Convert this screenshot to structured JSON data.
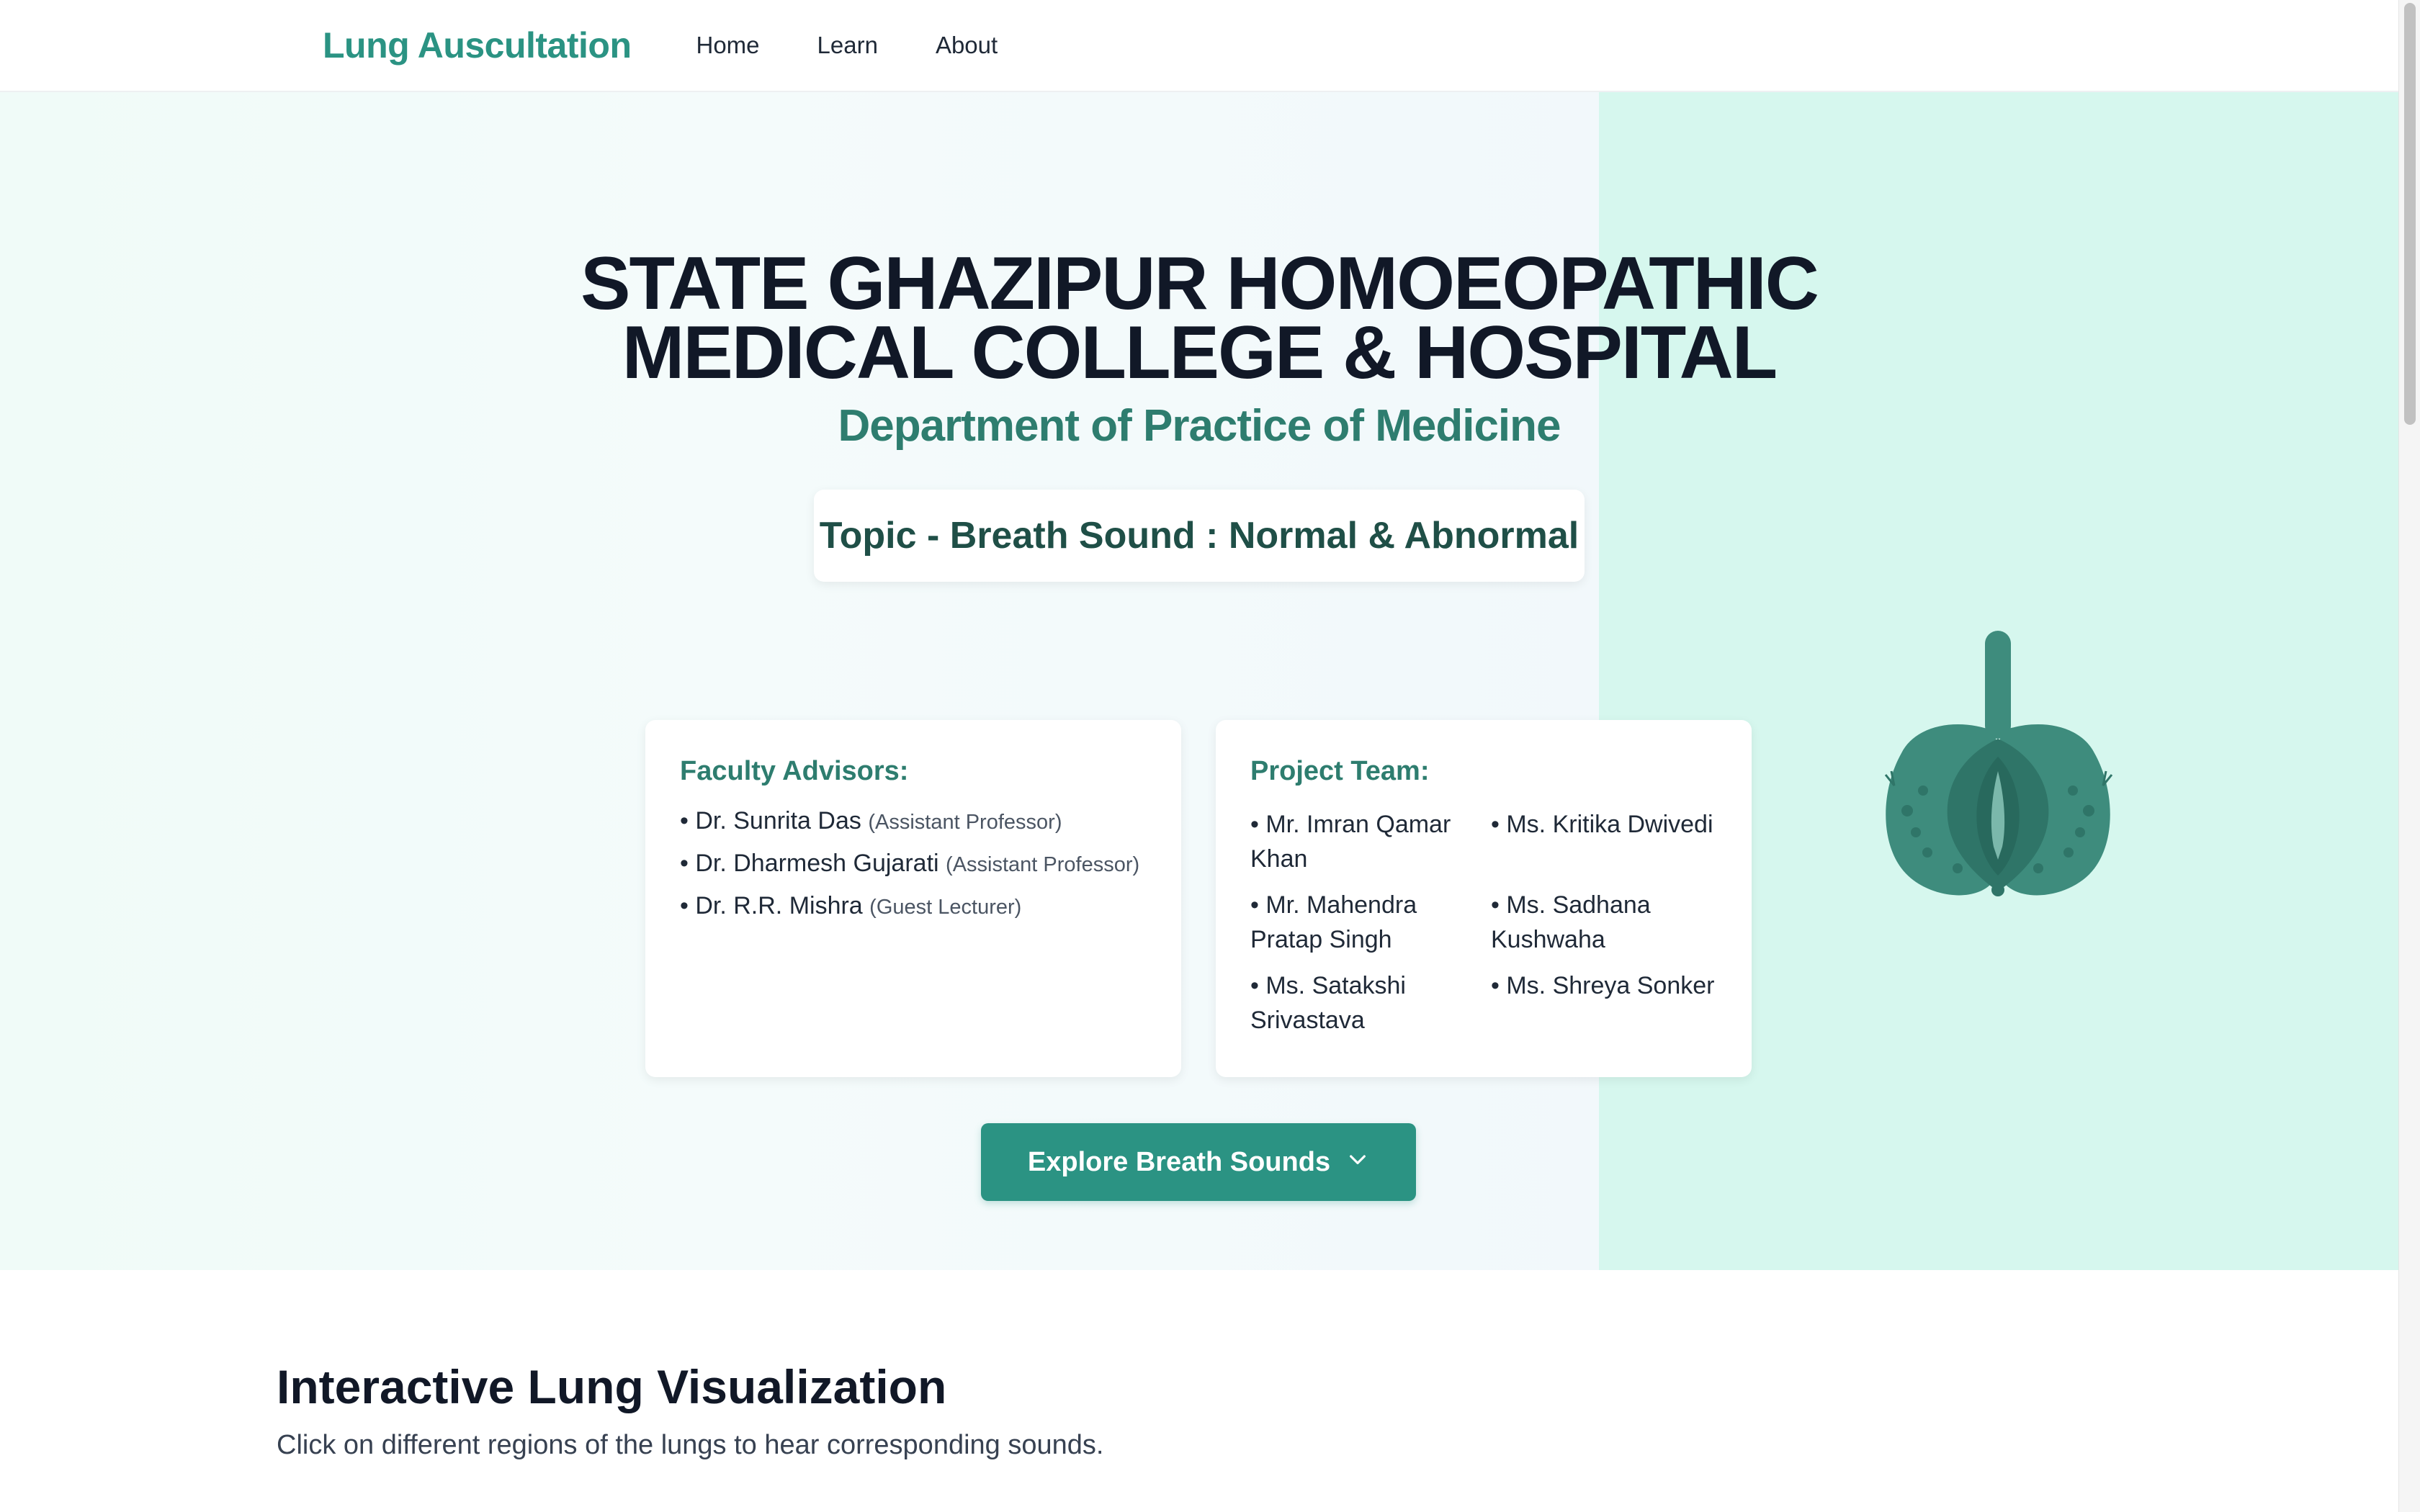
{
  "nav": {
    "brand": "Lung Auscultation",
    "links": [
      "Home",
      "Learn",
      "About"
    ]
  },
  "hero": {
    "title_line1": "STATE GHAZIPUR HOMOEOPATHIC",
    "title_line2": "MEDICAL COLLEGE & HOSPITAL",
    "subtitle": "Department of Practice of Medicine",
    "topic": "Topic - Breath Sound : Normal & Abnormal",
    "faculty": {
      "heading": "Faculty Advisors:",
      "members": [
        {
          "name": "• Dr. Sunrita Das",
          "role": "(Assistant Professor)"
        },
        {
          "name": "• Dr. Dharmesh Gujarati",
          "role": "(Assistant Professor)"
        },
        {
          "name": "• Dr. R.R. Mishra",
          "role": "(Guest Lecturer)"
        }
      ]
    },
    "team": {
      "heading": "Project Team:",
      "members": [
        "• Mr. Imran Qamar Khan",
        "• Ms. Kritika Dwivedi",
        "• Mr. Mahendra Pratap Singh",
        "• Ms. Sadhana Kushwaha",
        "• Ms. Satakshi Srivastava",
        "• Ms. Shreya Sonker"
      ]
    },
    "explore_button": "Explore Breath Sounds",
    "explore_icon": "chevron-down-icon",
    "illustration_icon": "lungs-icon"
  },
  "section": {
    "title": "Interactive Lung Visualization",
    "description": "Click on different regions of the lungs to hear corresponding sounds."
  },
  "colors": {
    "accent": "#2b9383",
    "accent_dark": "#2e7d6f",
    "hero_panel": "#d6f7ee",
    "title": "#111827"
  }
}
